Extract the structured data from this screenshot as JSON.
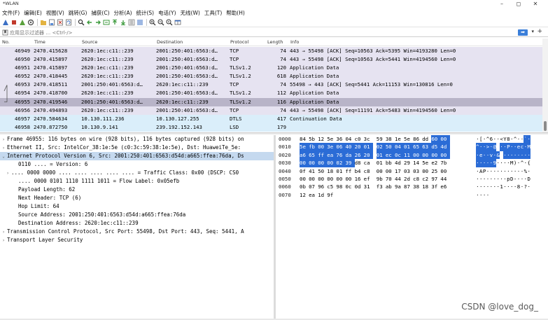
{
  "window": {
    "title": "*WLAN",
    "minimize": "–",
    "maximize": "◻",
    "close": "✕"
  },
  "menu": [
    "文件(F)",
    "编辑(E)",
    "视图(V)",
    "跳转(G)",
    "捕获(C)",
    "分析(A)",
    "统计(S)",
    "电话(Y)",
    "无线(W)",
    "工具(T)",
    "帮助(H)"
  ],
  "filter": {
    "placeholder": "应用显示过滤器 … <Ctrl-/>",
    "apply": "➡",
    "dropdown": "▾",
    "add": "+"
  },
  "columns": [
    "No.",
    "Time",
    "Source",
    "Destination",
    "Protocol",
    "Length",
    "Info"
  ],
  "packets": [
    {
      "no": "46949",
      "time": "2470.415628",
      "src": "2620:1ec:c11::239",
      "dst": "2001:250:401:6563:d…",
      "proto": "TCP",
      "len": "74",
      "info": "443 → 55498 [ACK] Seq=10563 Ack=5395 Win=4193280 Len=0",
      "kind": "tcp"
    },
    {
      "no": "46950",
      "time": "2470.415897",
      "src": "2620:1ec:c11::239",
      "dst": "2001:250:401:6563:d…",
      "proto": "TCP",
      "len": "74",
      "info": "443 → 55498 [ACK] Seq=10563 Ack=5441 Win=4194560 Len=0",
      "kind": "tcp"
    },
    {
      "no": "46951",
      "time": "2470.415897",
      "src": "2620:1ec:c11::239",
      "dst": "2001:250:401:6563:d…",
      "proto": "TLSv1.2",
      "len": "120",
      "info": "Application Data",
      "kind": "tls"
    },
    {
      "no": "46952",
      "time": "2470.418445",
      "src": "2620:1ec:c11::239",
      "dst": "2001:250:401:6563:d…",
      "proto": "TLSv1.2",
      "len": "618",
      "info": "Application Data",
      "kind": "tls"
    },
    {
      "no": "46953",
      "time": "2470.418511",
      "src": "2001:250:401:6563:d…",
      "dst": "2620:1ec:c11::239",
      "proto": "TCP",
      "len": "74",
      "info": "55498 → 443 [ACK] Seq=5441 Ack=11153 Win=130816 Len=0",
      "kind": "tcp"
    },
    {
      "no": "46954",
      "time": "2470.418700",
      "src": "2620:1ec:c11::239",
      "dst": "2001:250:401:6563:d…",
      "proto": "TLSv1.2",
      "len": "112",
      "info": "Application Data",
      "kind": "tls"
    },
    {
      "no": "46955",
      "time": "2470.419546",
      "src": "2001:250:401:6563:d…",
      "dst": "2620:1ec:c11::239",
      "proto": "TLSv1.2",
      "len": "116",
      "info": "Application Data",
      "kind": "sel"
    },
    {
      "no": "46956",
      "time": "2470.494893",
      "src": "2620:1ec:c11::239",
      "dst": "2001:250:401:6563:d…",
      "proto": "TCP",
      "len": "74",
      "info": "443 → 55498 [ACK] Seq=11191 Ack=5483 Win=4194560 Len=0",
      "kind": "tcp"
    },
    {
      "no": "46957",
      "time": "2470.584634",
      "src": "10.130.111.236",
      "dst": "10.130.127.255",
      "proto": "DTLS",
      "len": "417",
      "info": "Continuation Data",
      "kind": "udp"
    },
    {
      "no": "46958",
      "time": "2470.872750",
      "src": "10.130.9.141",
      "dst": "239.192.152.143",
      "proto": "LSD",
      "len": "179",
      "info": "",
      "kind": "udp"
    }
  ],
  "details": [
    {
      "arrow": "›",
      "level": 0,
      "hl": false,
      "text": "Frame 46955: 116 bytes on wire (928 bits), 116 bytes captured (928 bits) on"
    },
    {
      "arrow": "›",
      "level": 0,
      "hl": false,
      "text": "Ethernet II, Src: IntelCor_38:1e:5e (c0:3c:59:38:1e:5e), Dst: HuaweiTe_5e:"
    },
    {
      "arrow": "⌄",
      "level": 0,
      "hl": true,
      "text": "Internet Protocol Version 6, Src: 2001:250:401:6563:d54d:a665:ffea:76da, Ds"
    },
    {
      "arrow": "",
      "level": 1,
      "hl": false,
      "text": "0110 .... = Version: 6"
    },
    {
      "arrow": "›",
      "level": 2,
      "hl": false,
      "text": ".... 0000 0000 .... .... .... .... .... = Traffic Class: 0x00 (DSCP: CS0"
    },
    {
      "arrow": "",
      "level": 1,
      "hl": false,
      "text": ".... 0000 0101 1110 1111 1011 = Flow Label: 0x05efb"
    },
    {
      "arrow": "",
      "level": 1,
      "hl": false,
      "text": "Payload Length: 62"
    },
    {
      "arrow": "",
      "level": 1,
      "hl": false,
      "text": "Next Header: TCP (6)"
    },
    {
      "arrow": "",
      "level": 1,
      "hl": false,
      "text": "Hop Limit: 64"
    },
    {
      "arrow": "",
      "level": 1,
      "hl": false,
      "text": "Source Address: 2001:250:401:6563:d54d:a665:ffea:76da"
    },
    {
      "arrow": "",
      "level": 1,
      "hl": false,
      "text": "Destination Address: 2620:1ec:c11::239"
    },
    {
      "arrow": "›",
      "level": 0,
      "hl": false,
      "text": "Transmission Control Protocol, Src Port: 55498, Dst Port: 443, Seq: 5441, A"
    },
    {
      "arrow": "›",
      "level": 0,
      "hl": false,
      "text": "Transport Layer Security"
    }
  ],
  "bytes": [
    {
      "offset": "0000",
      "hex": [
        "84",
        "5b",
        "12",
        "5e",
        "36",
        "04",
        "c0",
        "3c",
        "59",
        "38",
        "1e",
        "5e",
        "86",
        "dd",
        "60",
        "00"
      ],
      "ascii": "·[·^6··<Y8·^··`·",
      "sel_from": 14,
      "sel_to": 16
    },
    {
      "offset": "0010",
      "hex": [
        "5e",
        "fb",
        "00",
        "3e",
        "06",
        "40",
        "20",
        "01",
        "02",
        "50",
        "04",
        "01",
        "65",
        "63",
        "d5",
        "4d"
      ],
      "ascii": "^··>·@ ··P··ec·M",
      "sel_from": 0,
      "sel_to": 16
    },
    {
      "offset": "0020",
      "hex": [
        "a6",
        "65",
        "ff",
        "ea",
        "76",
        "da",
        "26",
        "20",
        "01",
        "ec",
        "0c",
        "11",
        "00",
        "00",
        "00",
        "00"
      ],
      "ascii": "·e··v·& ········",
      "sel_from": 0,
      "sel_to": 16
    },
    {
      "offset": "0030",
      "hex": [
        "00",
        "00",
        "00",
        "00",
        "02",
        "39",
        "d8",
        "ca",
        "01",
        "bb",
        "4d",
        "29",
        "14",
        "5e",
        "e2",
        "7b"
      ],
      "ascii": "·····9····M)·^·{",
      "sel_from": 0,
      "sel_to": 6
    },
    {
      "offset": "0040",
      "hex": [
        "0f",
        "41",
        "50",
        "18",
        "01",
        "ff",
        "b4",
        "c8",
        "00",
        "00",
        "17",
        "03",
        "03",
        "00",
        "25",
        "00"
      ],
      "ascii": "·AP···········%·",
      "sel_from": 0,
      "sel_to": 0
    },
    {
      "offset": "0050",
      "hex": [
        "00",
        "00",
        "00",
        "00",
        "00",
        "00",
        "16",
        "ef",
        "9b",
        "70",
        "44",
        "2d",
        "c8",
        "c2",
        "97",
        "44"
      ],
      "ascii": "·········pD-···D",
      "sel_from": 0,
      "sel_to": 0
    },
    {
      "offset": "0060",
      "hex": [
        "0b",
        "07",
        "96",
        "c5",
        "98",
        "0c",
        "0d",
        "31",
        "f3",
        "ab",
        "9a",
        "87",
        "38",
        "18",
        "3f",
        "e6"
      ],
      "ascii": "·······1····8·?·",
      "sel_from": 0,
      "sel_to": 0
    },
    {
      "offset": "0070",
      "hex": [
        "12",
        "ea",
        "1d",
        "9f"
      ],
      "ascii": "····",
      "sel_from": 0,
      "sel_to": 0
    }
  ],
  "watermark": "CSDN @love_dog_",
  "colors": {
    "tcp_row": "#e6e3f1",
    "selected_row": "#b8b4c8",
    "udp_row": "#daeefa",
    "byte_selection": "#2b6cd6",
    "detail_highlight": "#c5d9ef"
  }
}
